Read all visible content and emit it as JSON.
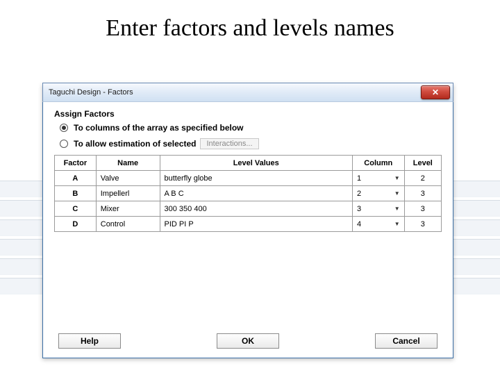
{
  "slide_title": "Enter factors and levels names",
  "window": {
    "title": "Taguchi Design - Factors",
    "section_label": "Assign Factors",
    "radio1": {
      "label": "To columns of the array as specified below",
      "checked": true
    },
    "radio2": {
      "label": "To allow estimation of selected",
      "checked": false
    },
    "interactions_btn": "Interactions...",
    "headers": {
      "factor": "Factor",
      "name": "Name",
      "level_values": "Level Values",
      "column": "Column",
      "level": "Level"
    },
    "rows": [
      {
        "factor": "A",
        "name": "Valve",
        "level_values": "butterfly globe",
        "column": "1",
        "level": "2"
      },
      {
        "factor": "B",
        "name": "Impellerl",
        "level_values": "A B C",
        "column": "2",
        "level": "3"
      },
      {
        "factor": "C",
        "name": "Mixer",
        "level_values": "300 350 400",
        "column": "3",
        "level": "3"
      },
      {
        "factor": "D",
        "name": "Control",
        "level_values": "PID PI P",
        "column": "4",
        "level": "3"
      }
    ],
    "buttons": {
      "help": "Help",
      "ok": "OK",
      "cancel": "Cancel"
    }
  }
}
